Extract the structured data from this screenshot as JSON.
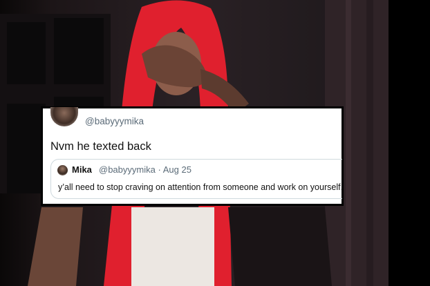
{
  "tweet": {
    "handle": "@babyyymika",
    "text": "Nvm he texted back",
    "quoted": {
      "name": "Mika",
      "handle": "@babyyymika",
      "separator": "·",
      "date": "Aug 25",
      "text": "y’all need to stop craving on attention from someone and work on yourself."
    }
  },
  "colors": {
    "hair": "#e0202e",
    "background": "#231b1f",
    "handle_gray": "#5b6b78"
  }
}
